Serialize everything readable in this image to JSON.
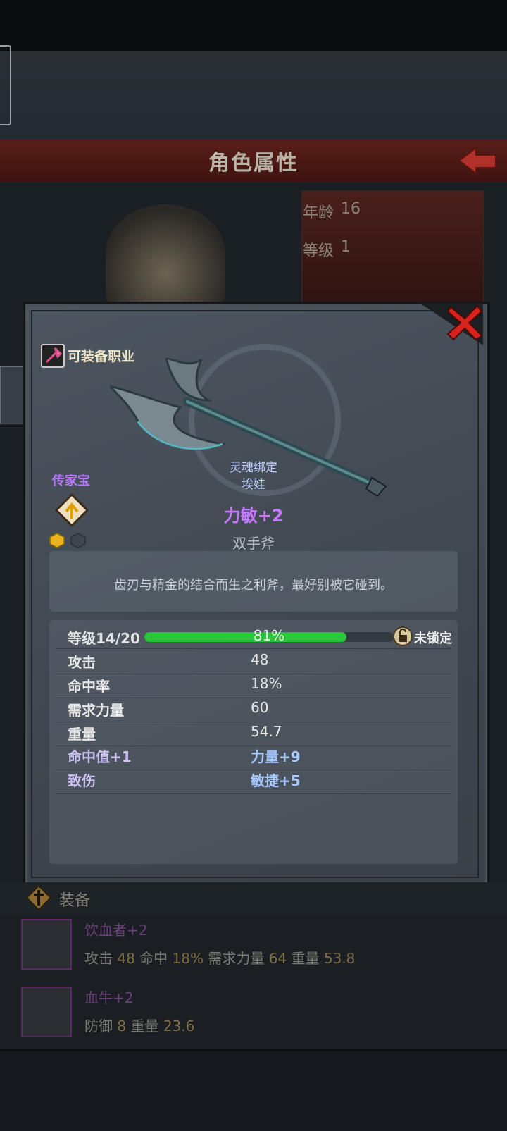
{
  "header": {
    "title": "角色属性"
  },
  "background_info": {
    "age_label": "年龄",
    "age_value": "16",
    "level_label": "等级",
    "level_value": "1"
  },
  "item": {
    "class_label": "可装备职业",
    "rarity_label": "传家宝",
    "soulbound_line1": "灵魂绑定",
    "soulbound_line2": "埃娃",
    "bonus": "力敏+2",
    "weapon_type": "双手斧",
    "description": "齿刃与精金的结合而生之利斧，最好别被它碰到。",
    "level_label": "等级14/20",
    "level_progress_percent": 81,
    "level_progress_text": "81%",
    "lock_text": "未锁定",
    "stats": [
      {
        "label": "攻击",
        "value": "48"
      },
      {
        "label": "命中率",
        "value": "18%"
      },
      {
        "label": "需求力量",
        "value": "60"
      },
      {
        "label": "重量",
        "value": "54.7"
      }
    ],
    "affixes": [
      {
        "left": "命中值+1",
        "right": "力量+9"
      },
      {
        "left": "致伤",
        "right": "敏捷+5"
      }
    ]
  },
  "equipment": {
    "title": "装备",
    "items": [
      {
        "name": "饮血者+2",
        "stats": [
          [
            "攻击",
            "48"
          ],
          [
            "命中",
            "18%"
          ],
          [
            "需求力量",
            "64"
          ],
          [
            "重量",
            "53.8"
          ]
        ]
      },
      {
        "name": "血牛+2",
        "stats": [
          [
            "防御",
            "8"
          ],
          [
            "重量",
            "23.6"
          ]
        ]
      }
    ]
  },
  "icons": {
    "close": "close-x-icon",
    "lock": "lock-icon",
    "class": "axe-class-icon",
    "heirloom": "heirloom-icon",
    "back": "back-arrow-icon",
    "equipment": "equipment-icon"
  },
  "colors": {
    "heirloom_purple": "#b678ff",
    "bonus_purple": "#c777ff",
    "progress_green": "#28c43a",
    "close_red": "#d8221c"
  }
}
